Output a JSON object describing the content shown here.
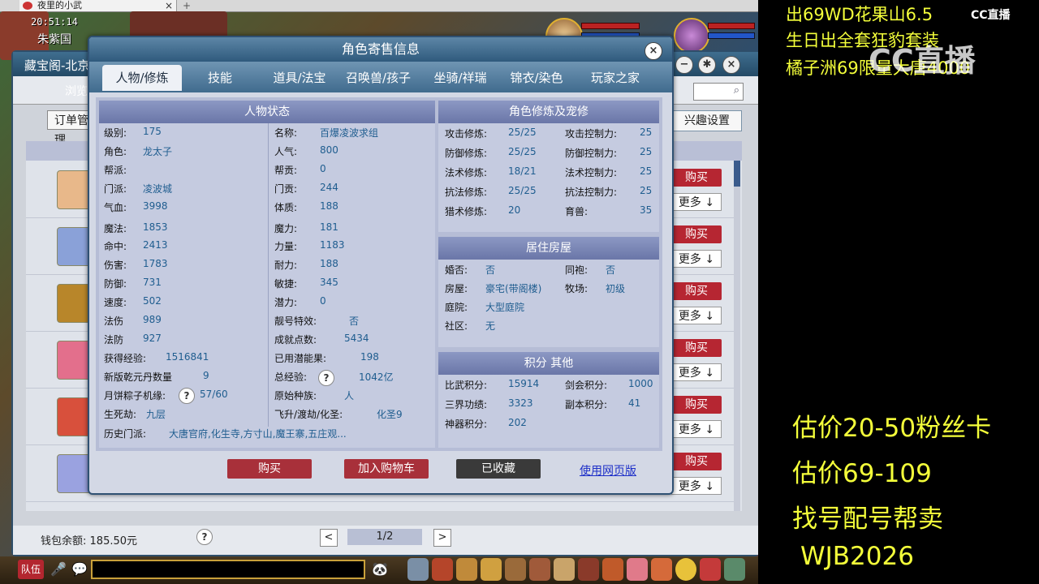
{
  "browser": {
    "tab_title": "夜里的小武",
    "close": "×",
    "add": "+"
  },
  "game": {
    "clock": "20:51:14",
    "region": "朱紫国"
  },
  "store": {
    "title": "藏宝阁-北京",
    "browse_label": "浏览",
    "order_label": "订单管理",
    "interest_label": "兴趣设置",
    "buy_label": "购买",
    "more_label": "更多",
    "wallet_label": "钱包余额:",
    "wallet_value": "185.50元",
    "page": "1/2",
    "prev": "<",
    "next": ">",
    "help": "?"
  },
  "dialog": {
    "title": "角色寄售信息",
    "close": "×",
    "tabs": [
      "人物/修炼",
      "技能",
      "道具/法宝",
      "召唤兽/孩子",
      "坐骑/祥瑞",
      "锦衣/染色",
      "玩家之家"
    ],
    "status_header": "人物状态",
    "cultivation_header": "角色修炼及宠修",
    "house_header": "居住房屋",
    "points_header": "积分 其他",
    "status_left": [
      {
        "label": "级别:",
        "value": "175"
      },
      {
        "label": "角色:",
        "value": "龙太子"
      },
      {
        "label": "帮派:",
        "value": ""
      },
      {
        "label": "门派:",
        "value": "凌波城"
      },
      {
        "label": "气血:",
        "value": "3998"
      },
      {
        "label": "魔法:",
        "value": "1853"
      },
      {
        "label": "命中:",
        "value": "2413"
      },
      {
        "label": "伤害:",
        "value": "1783"
      },
      {
        "label": "防御:",
        "value": "731"
      },
      {
        "label": "速度:",
        "value": "502"
      },
      {
        "label": "法伤",
        "value": "989"
      },
      {
        "label": "法防",
        "value": "927"
      },
      {
        "label": "获得经验:",
        "value": "1516841"
      },
      {
        "label": "新版乾元丹数量",
        "value": "9"
      },
      {
        "label": "月饼粽子机缘:",
        "value": "57/60"
      },
      {
        "label": "生死劫:",
        "value": "九层"
      }
    ],
    "status_right": [
      {
        "label": "名称:",
        "value": "百爆凌波求组"
      },
      {
        "label": "人气:",
        "value": "800"
      },
      {
        "label": "帮贡:",
        "value": "0"
      },
      {
        "label": "门贡:",
        "value": "244"
      },
      {
        "label": "体质:",
        "value": "188"
      },
      {
        "label": "魔力:",
        "value": "181"
      },
      {
        "label": "力量:",
        "value": "1183"
      },
      {
        "label": "耐力:",
        "value": "188"
      },
      {
        "label": "敏捷:",
        "value": "345"
      },
      {
        "label": "潜力:",
        "value": "0"
      },
      {
        "label": "靓号特效:",
        "value": "否"
      },
      {
        "label": "成就点数:",
        "value": "5434"
      },
      {
        "label": "已用潜能果:",
        "value": "198"
      },
      {
        "label": "总经验:",
        "value": "1042亿"
      },
      {
        "label": "原始种族:",
        "value": "人"
      },
      {
        "label": "飞升/渡劫/化圣:",
        "value": "化圣9"
      }
    ],
    "history_label": "历史门派:",
    "history_value": "大唐官府,化生寺,方寸山,魔王寨,五庄观...",
    "cultivation": [
      {
        "l1": "攻击修炼:",
        "v1": "25/25",
        "l2": "攻击控制力:",
        "v2": "25"
      },
      {
        "l1": "防御修炼:",
        "v1": "25/25",
        "l2": "防御控制力:",
        "v2": "25"
      },
      {
        "l1": "法术修炼:",
        "v1": "18/21",
        "l2": "法术控制力:",
        "v2": "25"
      },
      {
        "l1": "抗法修炼:",
        "v1": "25/25",
        "l2": "抗法控制力:",
        "v2": "25"
      },
      {
        "l1": "猎术修炼:",
        "v1": "20",
        "l2": "育兽:",
        "v2": "35"
      }
    ],
    "house": [
      {
        "l1": "婚否:",
        "v1": "否",
        "l2": "同袍:",
        "v2": "否"
      },
      {
        "l1": "房屋:",
        "v1": "豪宅(带阁楼)",
        "l2": "牧场:",
        "v2": "初级"
      },
      {
        "l1": "庭院:",
        "v1": "大型庭院",
        "l2": "",
        "v2": ""
      },
      {
        "l1": "社区:",
        "v1": "无",
        "l2": "",
        "v2": ""
      }
    ],
    "points": [
      {
        "l1": "比武积分:",
        "v1": "15914",
        "l2": "剑会积分:",
        "v2": "1000"
      },
      {
        "l1": "三界功绩:",
        "v1": "3323",
        "l2": "副本积分:",
        "v2": "41"
      },
      {
        "l1": "神器积分:",
        "v1": "202",
        "l2": "",
        "v2": ""
      }
    ],
    "buttons": {
      "buy": "购买",
      "add_cart": "加入购物车",
      "collected": "已收藏",
      "web": "使用网页版"
    }
  },
  "bottombar": {
    "team": "队伍"
  },
  "overlay": {
    "line1": "出69WD花果山6.5",
    "line2": "生日出全套狂豹套装",
    "line3": "橘子洲69限量大唐4000",
    "cc_logo": "CC直播",
    "est1": "估价20-50粉丝卡",
    "est2": "估价69-109",
    "service": "找号配号帮卖",
    "code": "WJB2026"
  },
  "colors": {
    "buy_red": "#b62632",
    "overlay_yellow": "#f4ff3a",
    "dialog_blue": "#2f5173"
  }
}
